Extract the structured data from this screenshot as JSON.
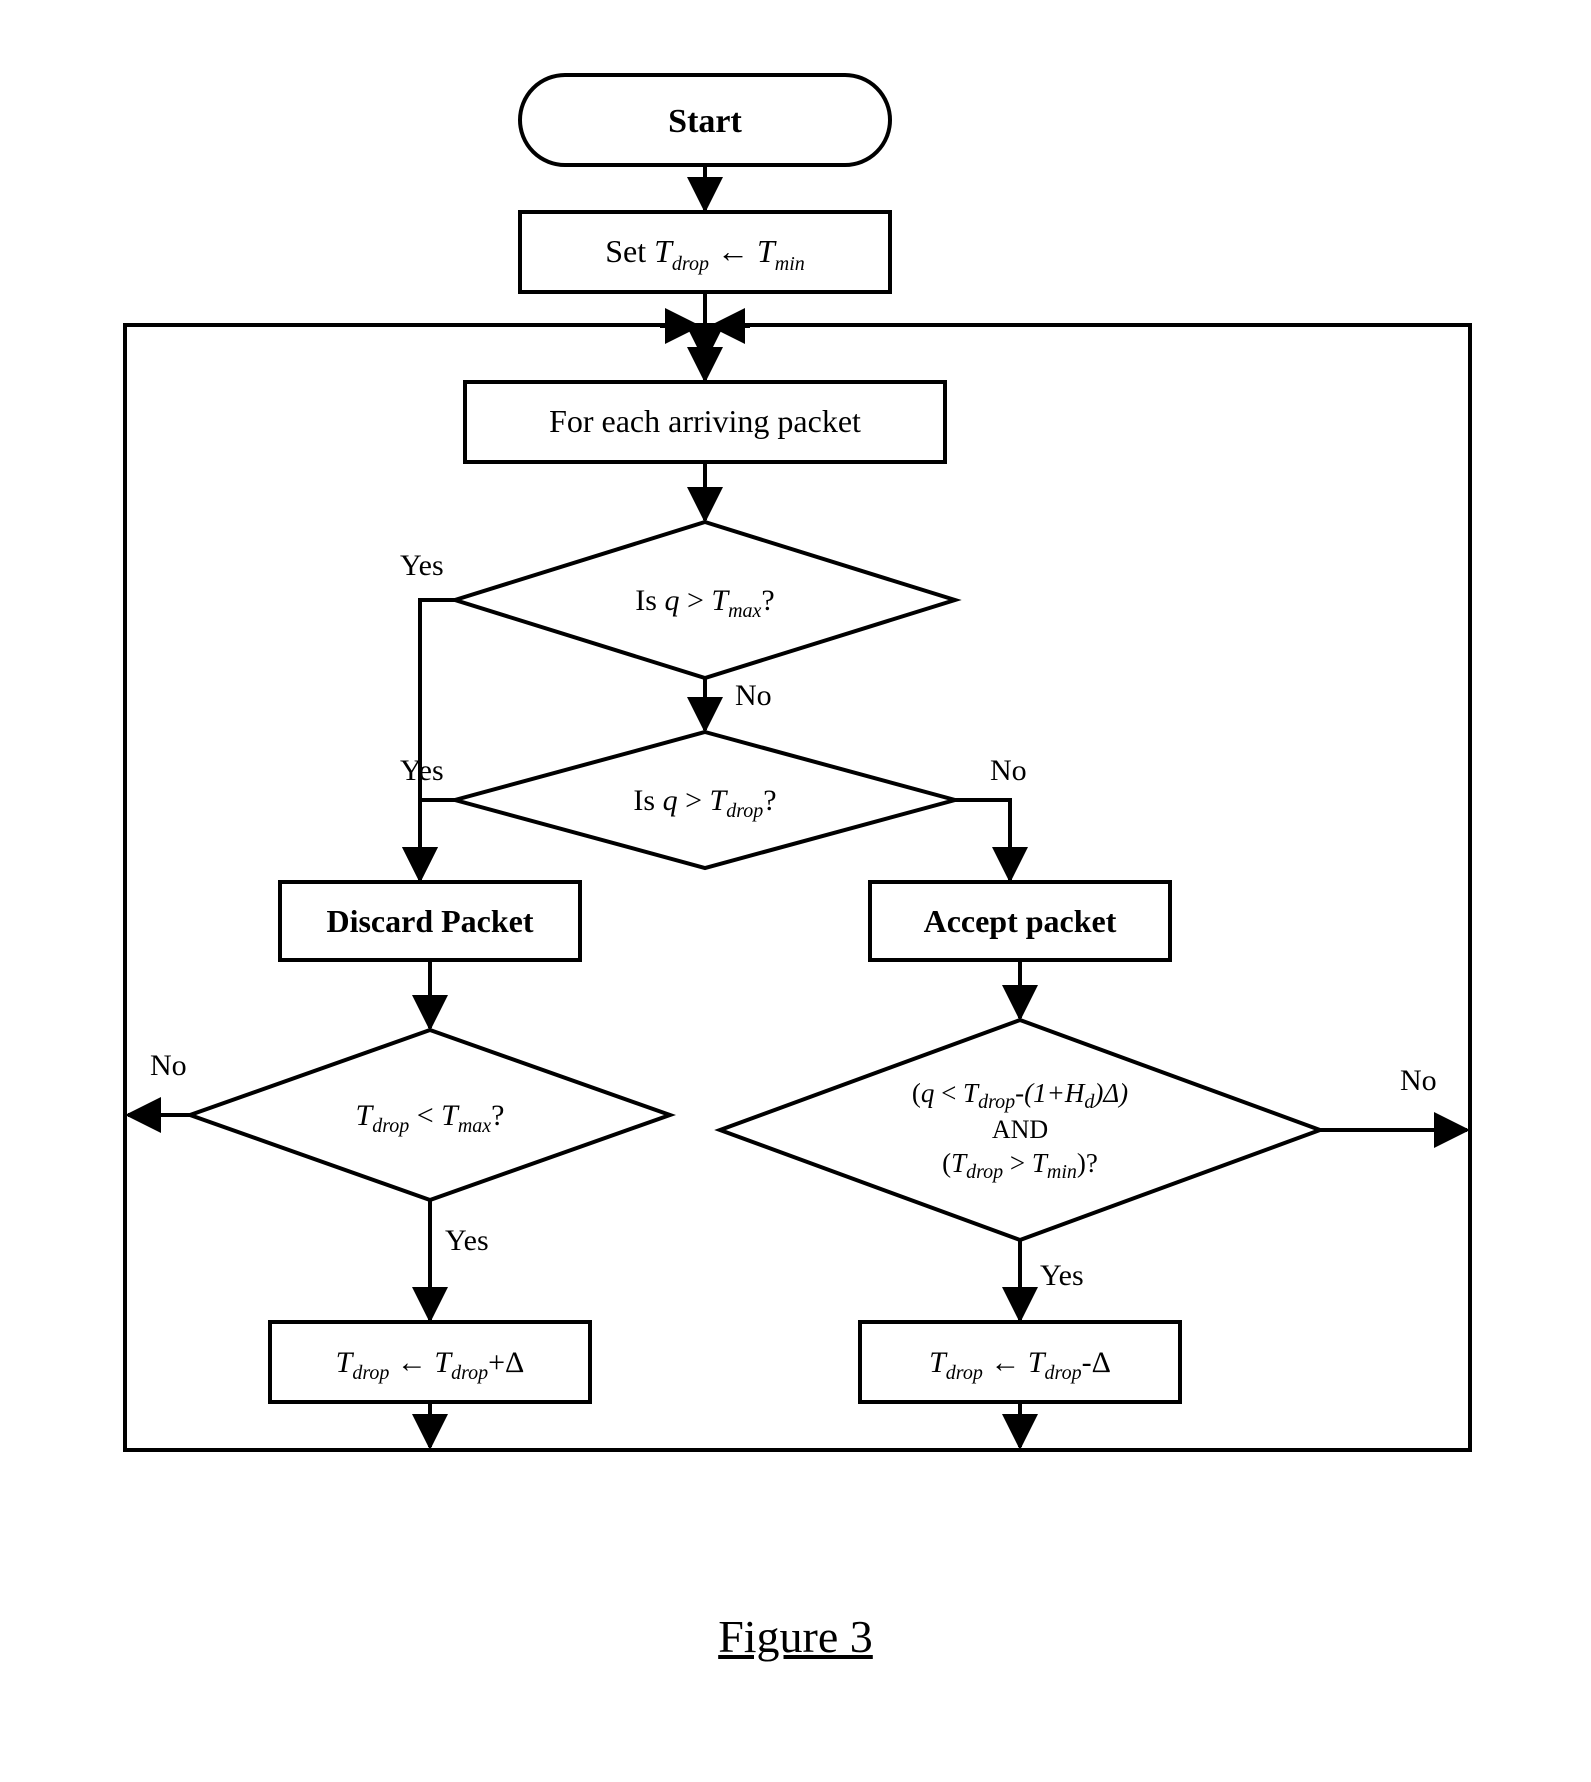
{
  "start": "Start",
  "set_tdrop_pre": "Set ",
  "var_T": "T",
  "sub_drop": "drop",
  "assign": " ← ",
  "sub_min": "min",
  "loop": "For each arriving packet",
  "is_pre": "Is ",
  "var_q": "q",
  "gt": " > ",
  "sub_max": "max",
  "qmark": "?",
  "discard": "Discard Packet",
  "accept": "Accept packet",
  "lt": " < ",
  "cond2_l1_pre": "(",
  "cond2_l1_mid": " < ",
  "cond2_l1_hd_pre": "-(1+",
  "var_H": "H",
  "sub_d": "d",
  "cond2_l1_hd_post": ")Δ)",
  "cond2_and": "AND",
  "cond2_l3_open": "(",
  "cond2_l3_gt": " > ",
  "cond2_l3_close": ")?",
  "plus_delta": "+Δ",
  "minus_delta": "-Δ",
  "yes": "Yes",
  "no": "No",
  "figure": "Figure 3"
}
